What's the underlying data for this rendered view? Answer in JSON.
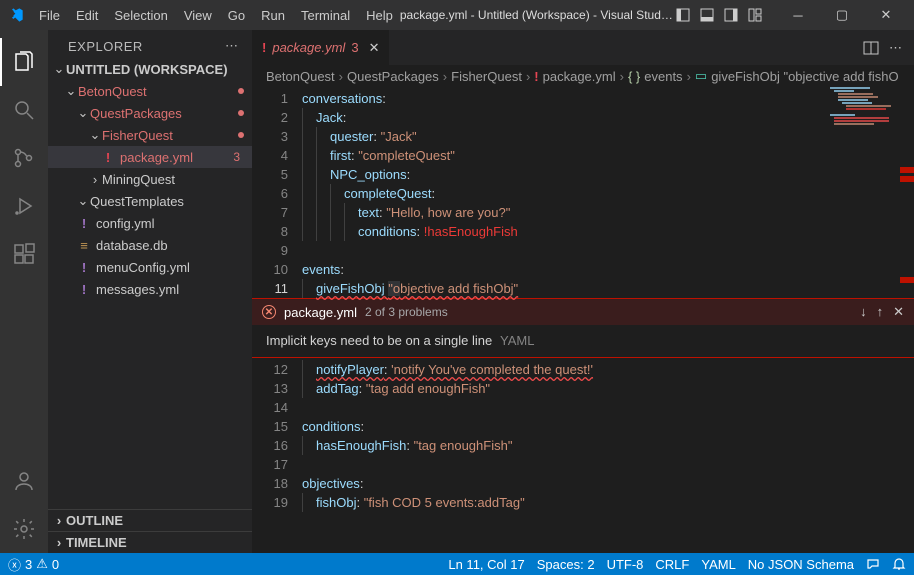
{
  "title": "package.yml - Untitled (Workspace) - Visual Studio...",
  "menus": [
    "File",
    "Edit",
    "Selection",
    "View",
    "Go",
    "Run",
    "Terminal",
    "Help"
  ],
  "explorer": {
    "title": "EXPLORER",
    "workspace": "UNTITLED (WORKSPACE)",
    "tree": [
      {
        "label": "BetonQuest",
        "depth": 1,
        "folder": true,
        "open": true,
        "mod": true,
        "dot": true
      },
      {
        "label": "QuestPackages",
        "depth": 2,
        "folder": true,
        "open": true,
        "mod": true,
        "dot": true
      },
      {
        "label": "FisherQuest",
        "depth": 3,
        "folder": true,
        "open": true,
        "mod": true,
        "dot": true
      },
      {
        "label": "package.yml",
        "depth": 4,
        "folder": false,
        "mod": true,
        "sel": true,
        "icon": "!",
        "iconColor": "#e64553",
        "badge": "3"
      },
      {
        "label": "MiningQuest",
        "depth": 3,
        "folder": true,
        "open": false
      },
      {
        "label": "QuestTemplates",
        "depth": 2,
        "folder": true,
        "open": true
      },
      {
        "label": "config.yml",
        "depth": 2,
        "folder": false,
        "icon": "!",
        "iconColor": "#a074c4"
      },
      {
        "label": "database.db",
        "depth": 2,
        "folder": false,
        "icon": "≡",
        "iconColor": "#c09553"
      },
      {
        "label": "menuConfig.yml",
        "depth": 2,
        "folder": false,
        "icon": "!",
        "iconColor": "#a074c4"
      },
      {
        "label": "messages.yml",
        "depth": 2,
        "folder": false,
        "icon": "!",
        "iconColor": "#a074c4"
      }
    ],
    "outline": "OUTLINE",
    "timeline": "TIMELINE"
  },
  "tab": {
    "icon": "!",
    "name": "package.yml",
    "num": "3"
  },
  "breadcrumb": {
    "parts": [
      "BetonQuest",
      "QuestPackages",
      "FisherQuest"
    ],
    "file": "package.yml",
    "node1": "events",
    "node2": "giveFishObj \"objective add fishO"
  },
  "code_top": [
    {
      "n": 1,
      "segs": [
        [
          "conversations",
          "key"
        ],
        [
          ":",
          "punct"
        ]
      ]
    },
    {
      "n": 2,
      "indent": 1,
      "segs": [
        [
          "Jack",
          "key"
        ],
        [
          ":",
          "punct"
        ]
      ]
    },
    {
      "n": 3,
      "indent": 2,
      "segs": [
        [
          "quester",
          "key"
        ],
        [
          ": ",
          "punct"
        ],
        [
          "\"Jack\"",
          "str"
        ]
      ]
    },
    {
      "n": 4,
      "indent": 2,
      "segs": [
        [
          "first",
          "key"
        ],
        [
          ": ",
          "punct"
        ],
        [
          "\"completeQuest\"",
          "str"
        ]
      ]
    },
    {
      "n": 5,
      "indent": 2,
      "segs": [
        [
          "NPC_options",
          "key"
        ],
        [
          ":",
          "punct"
        ]
      ]
    },
    {
      "n": 6,
      "indent": 3,
      "segs": [
        [
          "completeQuest",
          "key"
        ],
        [
          ":",
          "punct"
        ]
      ]
    },
    {
      "n": 7,
      "indent": 4,
      "segs": [
        [
          "text",
          "key"
        ],
        [
          ": ",
          "punct"
        ],
        [
          "\"Hello, how are you?\"",
          "str"
        ]
      ]
    },
    {
      "n": 8,
      "indent": 4,
      "segs": [
        [
          "conditions",
          "key"
        ],
        [
          ": ",
          "punct"
        ],
        [
          "!hasEnoughFish",
          "tag"
        ]
      ]
    },
    {
      "n": 9,
      "segs": []
    },
    {
      "n": 10,
      "segs": [
        [
          "events",
          "key"
        ],
        [
          ":",
          "punct"
        ]
      ]
    },
    {
      "n": 11,
      "cur": true,
      "indent": 1,
      "squiggle": true,
      "segs": [
        [
          "giveFishObj ",
          "key"
        ],
        [
          "\"o",
          "str-cursor"
        ],
        [
          "bjective add fishObj\"",
          "str"
        ]
      ]
    }
  ],
  "peek": {
    "file": "package.yml",
    "count": "2 of 3 problems",
    "msg": "Implicit keys need to be on a single line",
    "tag": "YAML"
  },
  "code_bottom": [
    {
      "n": 12,
      "indent": 1,
      "squiggle": true,
      "segs": [
        [
          "notifyPlayer",
          "key"
        ],
        [
          ": ",
          "punct"
        ],
        [
          "'notify You've completed the quest!'",
          "str"
        ]
      ]
    },
    {
      "n": 13,
      "indent": 1,
      "segs": [
        [
          "addTag",
          "key"
        ],
        [
          ": ",
          "punct"
        ],
        [
          "\"tag add enoughFish\"",
          "str"
        ]
      ]
    },
    {
      "n": 14,
      "segs": []
    },
    {
      "n": 15,
      "segs": [
        [
          "conditions",
          "key"
        ],
        [
          ":",
          "punct"
        ]
      ]
    },
    {
      "n": 16,
      "indent": 1,
      "segs": [
        [
          "hasEnoughFish",
          "key"
        ],
        [
          ": ",
          "punct"
        ],
        [
          "\"tag enoughFish\"",
          "str"
        ]
      ]
    },
    {
      "n": 17,
      "segs": []
    },
    {
      "n": 18,
      "segs": [
        [
          "objectives",
          "key"
        ],
        [
          ":",
          "punct"
        ]
      ]
    },
    {
      "n": 19,
      "indent": 1,
      "segs": [
        [
          "fishObj",
          "key"
        ],
        [
          ": ",
          "punct"
        ],
        [
          "\"fish COD 5 events:addTag\"",
          "str"
        ]
      ]
    }
  ],
  "status": {
    "errors": "3",
    "warnings": "0",
    "pos": "Ln 11, Col 17",
    "spaces": "Spaces: 2",
    "enc": "UTF-8",
    "eol": "CRLF",
    "lang": "YAML",
    "schema": "No JSON Schema"
  }
}
